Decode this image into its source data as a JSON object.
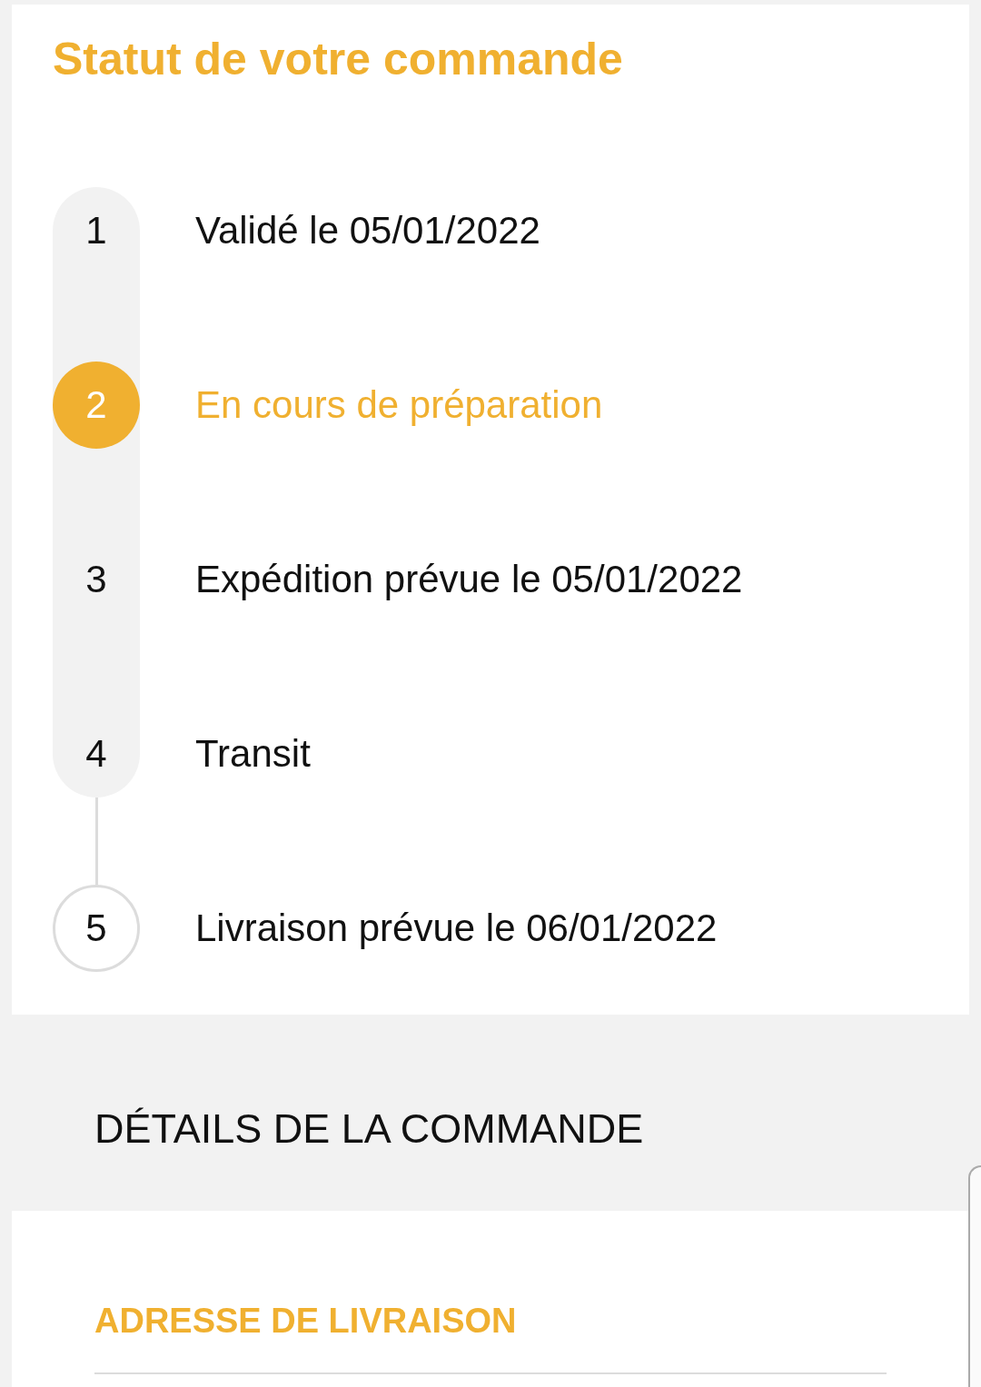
{
  "title": "Statut de votre commande",
  "steps": [
    {
      "number": "1",
      "label": "Validé le 05/01/2022",
      "selected": false,
      "shaded": true
    },
    {
      "number": "2",
      "label": "En cours de préparation",
      "selected": true,
      "shaded": true
    },
    {
      "number": "3",
      "label": "Expédition prévue le 05/01/2022",
      "selected": false,
      "shaded": true
    },
    {
      "number": "4",
      "label": "Transit",
      "selected": false,
      "shaded": true
    },
    {
      "number": "5",
      "label": "Livraison prévue le 06/01/2022",
      "selected": false,
      "shaded": false
    }
  ],
  "details": {
    "heading": "DÉTAILS DE LA COMMANDE"
  },
  "address": {
    "heading": "ADRESSE DE LIVRAISON"
  }
}
